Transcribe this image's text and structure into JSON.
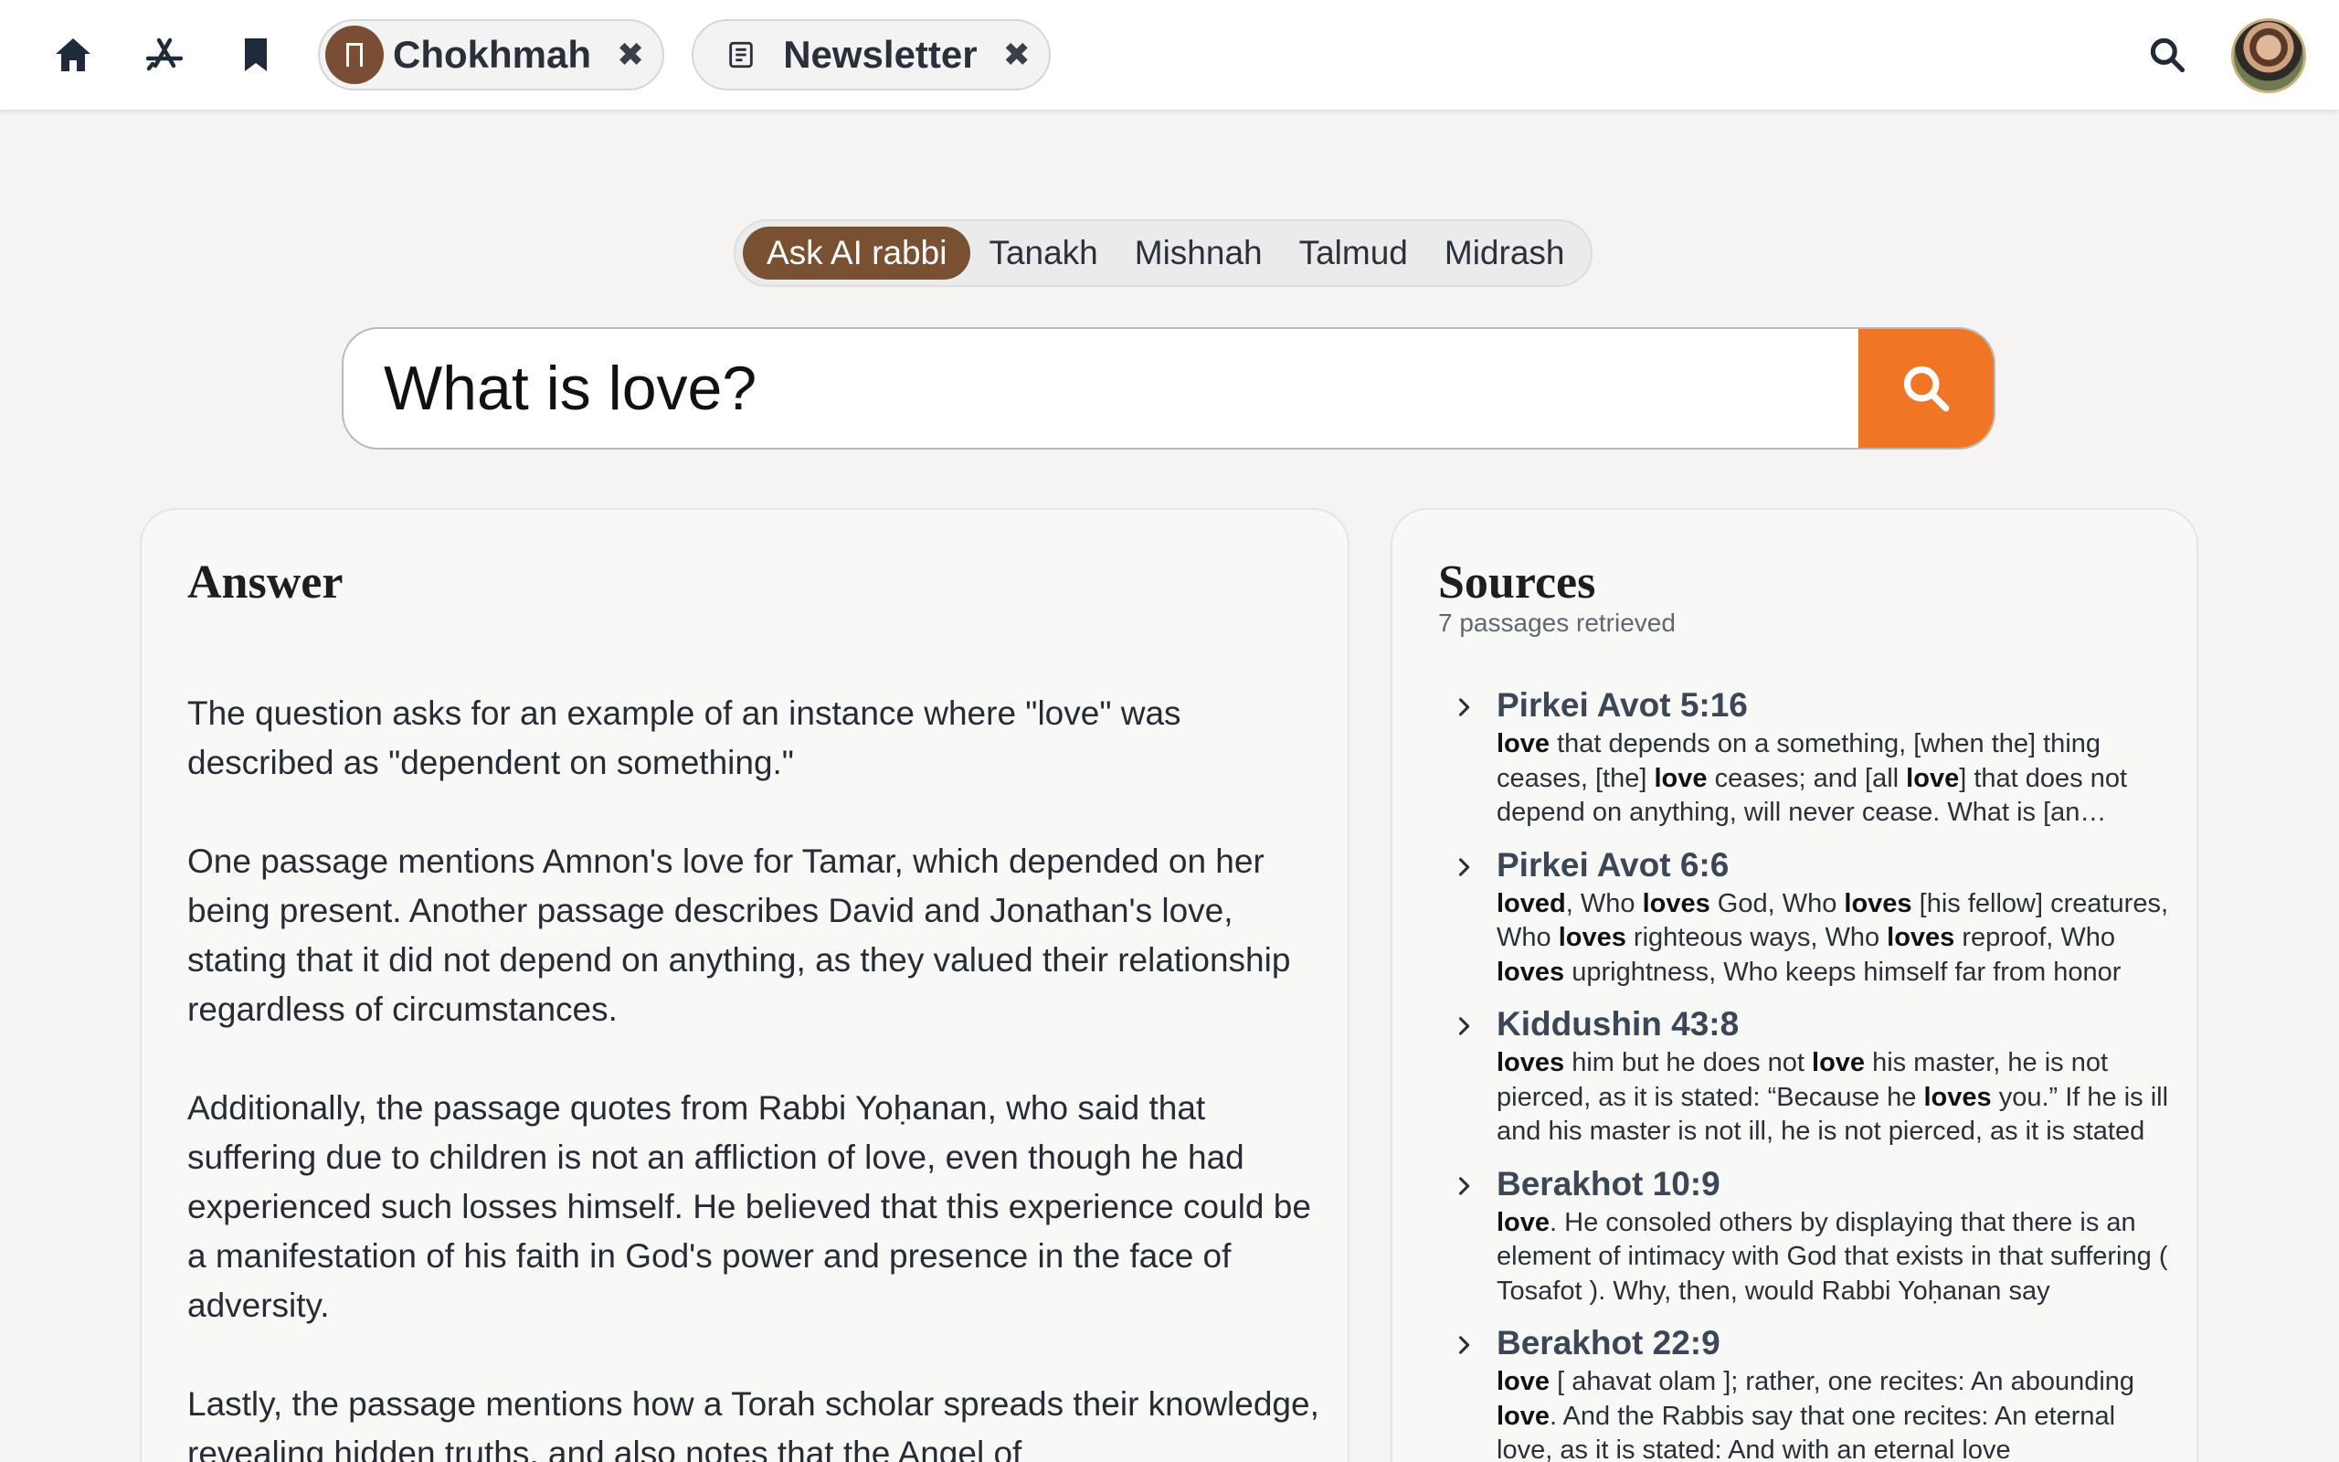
{
  "topbar": {
    "tabs": [
      {
        "label": "Chokhmah",
        "close": "✖"
      },
      {
        "label": "Newsletter",
        "close": "✖"
      }
    ]
  },
  "search": {
    "modes": [
      "Ask AI rabbi",
      "Tanakh",
      "Mishnah",
      "Talmud",
      "Midrash"
    ],
    "active_mode": "Ask AI rabbi",
    "query": "What is love?"
  },
  "answer": {
    "title": "Answer",
    "paragraphs": [
      "The question asks for an example of an instance where \"love\" was described as \"dependent on something.\"",
      "One passage mentions Amnon's love for Tamar, which depended on her being present. Another passage describes David and Jonathan's love, stating that it did not depend on anything, as they valued their relationship regardless of circumstances.",
      "Additionally, the passage quotes from Rabbi Yoḥanan, who said that suffering due to children is not an affliction of love, even though he had experienced such losses himself. He believed that this experience could be a manifestation of his faith in God's power and presence in the face of adversity.",
      "Lastly, the passage mentions how a Torah scholar spreads their knowledge, revealing hidden truths, and also notes that the Angel of"
    ]
  },
  "sources": {
    "title": "Sources",
    "count": "7 passages retrieved",
    "items": [
      {
        "title": "Pirkei Avot 5:16",
        "segments": [
          [
            "love",
            true
          ],
          [
            " that depends on a something, [when the] thing ceases, [the] ",
            false
          ],
          [
            "love",
            true
          ],
          [
            " ceases; and [all ",
            false
          ],
          [
            "love",
            true
          ],
          [
            "] that does not depend on anything, will never cease. What is [an example of] love that depends on something?",
            false
          ]
        ]
      },
      {
        "title": "Pirkei Avot 6:6",
        "segments": [
          [
            "loved",
            true
          ],
          [
            ", Who ",
            false
          ],
          [
            "loves",
            true
          ],
          [
            " God, Who ",
            false
          ],
          [
            "loves",
            true
          ],
          [
            " [his fellow] creatures, Who ",
            false
          ],
          [
            "loves",
            true
          ],
          [
            " righteous ways, Who ",
            false
          ],
          [
            "loves",
            true
          ],
          [
            " reproof, Who ",
            false
          ],
          [
            "loves",
            true
          ],
          [
            " uprightness, Who keeps himself far from honor",
            false
          ]
        ]
      },
      {
        "title": "Kiddushin 43:8",
        "segments": [
          [
            "loves",
            true
          ],
          [
            " him but he does not ",
            false
          ],
          [
            "love",
            true
          ],
          [
            " his master, he is not pierced, as it is stated: “Because he ",
            false
          ],
          [
            "loves",
            true
          ],
          [
            " you.” If he is ill and his master is not ill, he is not pierced, as it is stated",
            false
          ]
        ]
      },
      {
        "title": "Berakhot 10:9",
        "segments": [
          [
            "love",
            true
          ],
          [
            ". He consoled others by displaying that there is an element of intimacy with God that exists in that suffering ( Tosafot ). Why, then, would Rabbi Yoḥanan say",
            false
          ]
        ]
      },
      {
        "title": "Berakhot 22:9",
        "segments": [
          [
            "love",
            true
          ],
          [
            " [ ahavat olam ]; rather, one recites: An abounding ",
            false
          ],
          [
            "love",
            true
          ],
          [
            ". And the Rabbis say that one recites: An eternal love, as it is stated: And with an eternal love",
            false
          ]
        ]
      }
    ]
  }
}
